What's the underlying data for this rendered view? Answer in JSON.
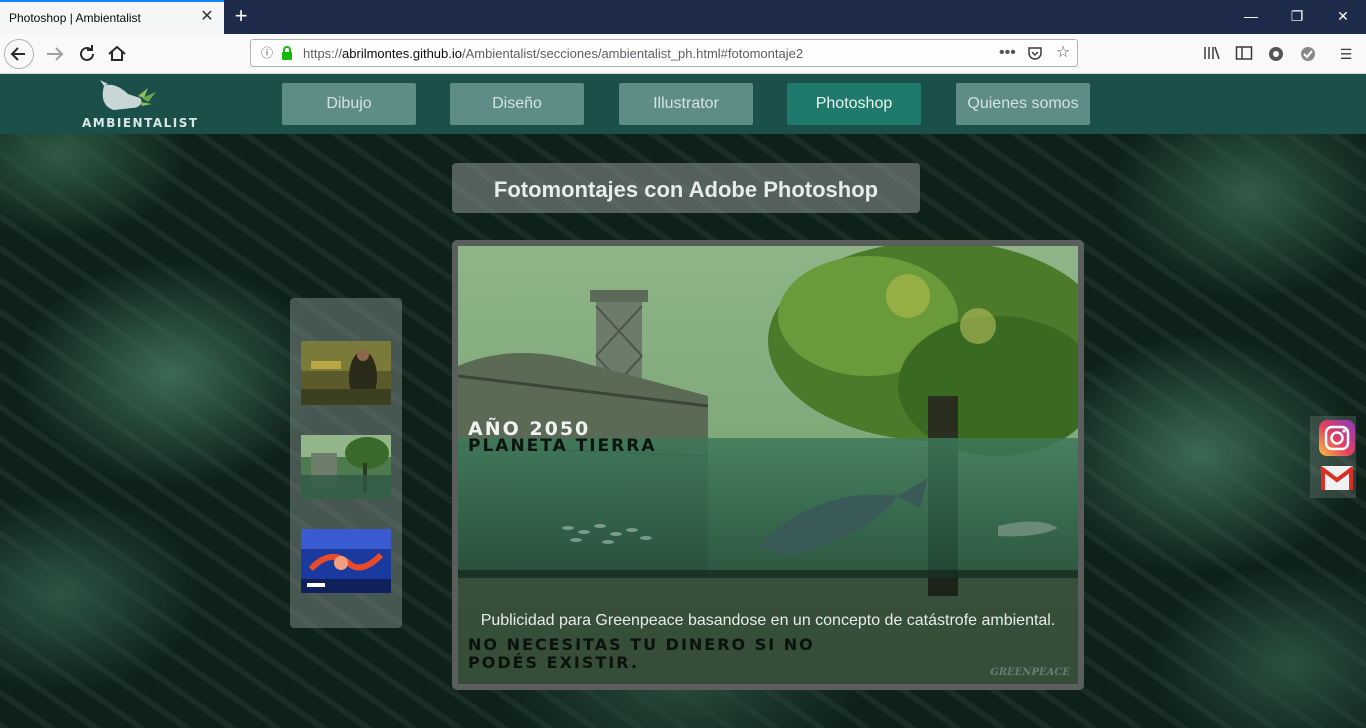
{
  "browser": {
    "tab_title": "Photoshop | Ambientalist",
    "tab_close_icon": "close-icon",
    "new_tab_icon": "plus-icon",
    "url_prefix": "https://",
    "url_host": "abrilmontes.github.io",
    "url_path": "/Ambientalist/secciones/ambientalist_ph.html#fotomontaje2"
  },
  "site": {
    "logo_text": "AMBIENTALIST",
    "menu": [
      {
        "label": "Dibujo"
      },
      {
        "label": "Diseño"
      },
      {
        "label": "Illustrator"
      },
      {
        "label": "Photoshop",
        "active": true
      },
      {
        "label": "Quienes somos"
      }
    ],
    "page_title": "Fotomontajes con Adobe Photoshop"
  },
  "viewer": {
    "poster_line1": "AÑO 2050",
    "poster_line2": "PLANETA TIERRA",
    "caption": "Publicidad para Greenpeace basandose en un concepto de catástrofe ambiental.",
    "poster_foot": "NO NECESITAS TU DINERO SI NO PODÉS EXISTIR.",
    "poster_brand": "GREENPEACE"
  },
  "colors": {
    "header_bg": "#1b4f4a",
    "menu_btn": "#5e8c87",
    "menu_active": "#1f7a6c"
  }
}
